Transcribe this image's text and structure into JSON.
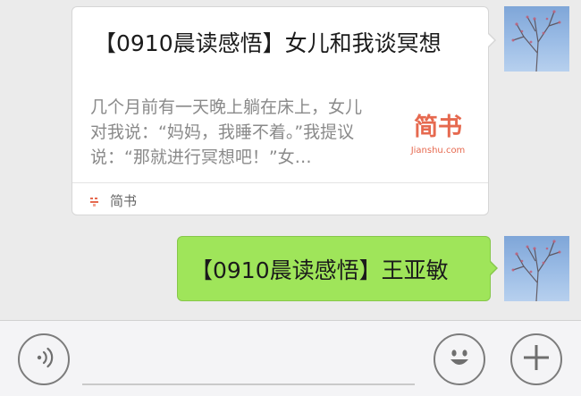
{
  "chat": {
    "link_card": {
      "title": "【0910晨读感悟】女儿和我谈冥想",
      "description": "几个月前有一天晚上躺在床上，女儿对我说：“妈妈，我睡不着。”我提议说：“那就进行冥想吧！”女…",
      "thumbnail_logo": "简书",
      "thumbnail_domain": "Jianshu.com",
      "source_name": "简书"
    },
    "text_message": {
      "text": "【0910晨读感悟】王亚敏"
    }
  },
  "input_bar": {
    "input_value": "",
    "icons": [
      "voice-icon",
      "emoji-icon",
      "plus-icon"
    ]
  },
  "colors": {
    "background": "#ebebeb",
    "bubble_green": "#9fe55a",
    "card_white": "#ffffff",
    "brand_red": "#e6694f"
  }
}
